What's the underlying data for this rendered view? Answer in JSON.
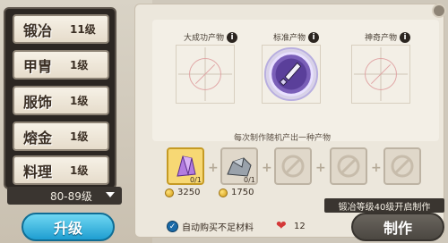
{
  "sidebar": {
    "items": [
      {
        "name": "锻冶",
        "level": "11级"
      },
      {
        "name": "甲胄",
        "level": "1级"
      },
      {
        "name": "服饰",
        "level": "1级"
      },
      {
        "name": "熔金",
        "level": "1级"
      },
      {
        "name": "料理",
        "level": "1级"
      }
    ],
    "level_filter": "80-89级",
    "upgrade_label": "升级"
  },
  "products": {
    "big_success_label": "大成功产物",
    "standard_label": "标准产物",
    "legendary_label": "神奇产物",
    "caption": "每次制作随机产出一种产物"
  },
  "materials": [
    {
      "qty": "0/1",
      "cost": "3250",
      "icon": "purple-crystal-icon"
    },
    {
      "qty": "0/1",
      "cost": "1750",
      "icon": "iron-ore-icon"
    },
    {
      "icon": "empty-slot-icon"
    },
    {
      "icon": "empty-slot-icon"
    },
    {
      "icon": "empty-slot-icon"
    }
  ],
  "requirement": "锻冶等级40级开启制作",
  "auto_buy_label": "自动购买不足材料",
  "hearts": "12",
  "make_label": "制作",
  "colors": {
    "accent": "#1f9ed1",
    "dark": "#2c2723",
    "panel": "#ece7dc"
  }
}
